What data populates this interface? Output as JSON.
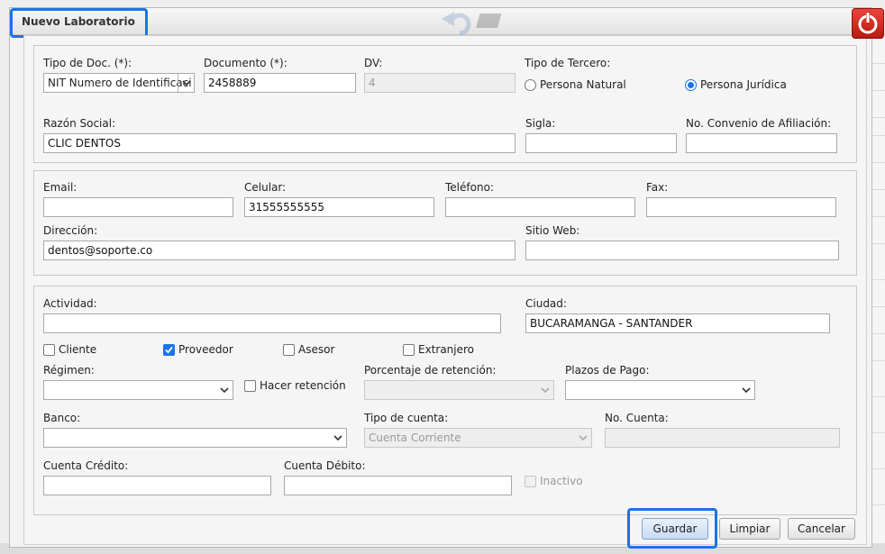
{
  "dialog": {
    "title": "Nuevo Laboratorio"
  },
  "section1": {
    "tipo_doc": {
      "label": "Tipo de Doc. (*):",
      "value": "NIT Numero de Identificaci"
    },
    "documento": {
      "label": "Documento (*):",
      "value": "2458889"
    },
    "dv": {
      "label": "DV:",
      "value": "4"
    },
    "tipo_tercero": {
      "label": "Tipo de Tercero:",
      "options": [
        "Persona Natural",
        "Persona Jurídica"
      ],
      "selected": "Persona Jurídica"
    },
    "razon_social": {
      "label": "Razón Social:",
      "value": "CLIC DENTOS"
    },
    "sigla": {
      "label": "Sigla:",
      "value": ""
    },
    "convenio": {
      "label": "No. Convenio de Afiliación:",
      "value": ""
    }
  },
  "section2": {
    "email": {
      "label": "Email:",
      "value": ""
    },
    "celular": {
      "label": "Celular:",
      "value": "31555555555"
    },
    "telefono": {
      "label": "Teléfono:",
      "value": ""
    },
    "fax": {
      "label": "Fax:",
      "value": ""
    },
    "direccion": {
      "label": "Dirección:",
      "value": "dentos@soporte.co"
    },
    "sitio_web": {
      "label": "Sitio Web:",
      "value": ""
    }
  },
  "section3": {
    "actividad": {
      "label": "Actividad:",
      "value": ""
    },
    "ciudad": {
      "label": "Ciudad:",
      "value": "BUCARAMANGA - SANTANDER"
    },
    "checkboxes": [
      {
        "label": "Cliente",
        "checked": false
      },
      {
        "label": "Proveedor",
        "checked": true
      },
      {
        "label": "Asesor",
        "checked": false
      },
      {
        "label": "Extranjero",
        "checked": false
      }
    ],
    "regimen": {
      "label": "Régimen:",
      "value": ""
    },
    "hacer_retencion": {
      "label": "Hacer retención",
      "checked": false
    },
    "porcentaje_retencion": {
      "label": "Porcentaje de retención:",
      "value": ""
    },
    "plazos_pago": {
      "label": "Plazos de Pago:",
      "value": ""
    },
    "banco": {
      "label": "Banco:",
      "value": ""
    },
    "tipo_cuenta": {
      "label": "Tipo de cuenta:",
      "value": "Cuenta Corriente"
    },
    "no_cuenta": {
      "label": "No. Cuenta:",
      "value": ""
    },
    "cuenta_credito": {
      "label": "Cuenta Crédito:",
      "value": ""
    },
    "cuenta_debito": {
      "label": "Cuenta Débito:",
      "value": ""
    },
    "inactivo": {
      "label": "Inactivo",
      "checked": false
    }
  },
  "buttons": {
    "guardar": "Guardar",
    "limpiar": "Limpiar",
    "cancelar": "Cancelar"
  },
  "colors": {
    "accent": "#1a73e8",
    "power": "#d0261c"
  }
}
